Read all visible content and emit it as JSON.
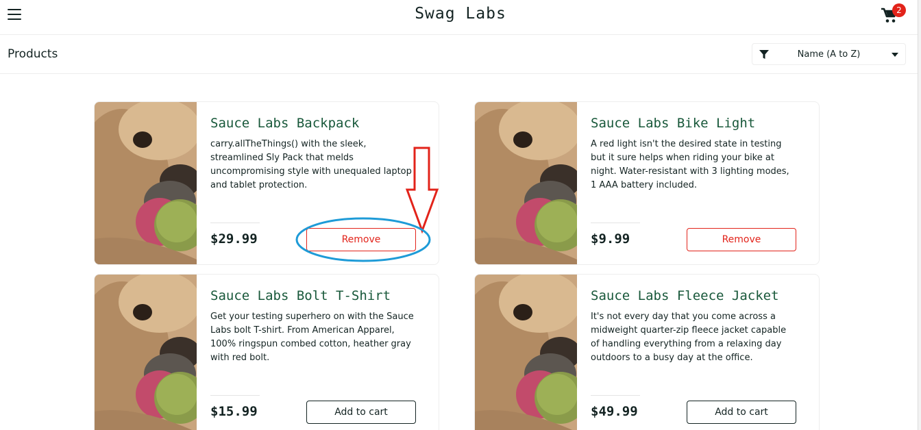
{
  "header": {
    "title": "Swag Labs",
    "menu_icon": "hamburger-menu-icon",
    "cart_icon": "shopping-cart-icon",
    "cart_count": "2"
  },
  "subheader": {
    "title": "Products",
    "sort": {
      "selected": "Name (A to Z)",
      "icon": "filter-icon"
    }
  },
  "products": [
    {
      "name": "Sauce Labs Backpack",
      "description": "carry.allTheThings() with the sleek, streamlined Sly Pack that melds uncompromising style with unequaled laptop and tablet protection.",
      "price": "$29.99",
      "button": "Remove",
      "in_cart": true
    },
    {
      "name": "Sauce Labs Bike Light",
      "description": "A red light isn't the desired state in testing but it sure helps when riding your bike at night. Water-resistant with 3 lighting modes, 1 AAA battery included.",
      "price": "$9.99",
      "button": "Remove",
      "in_cart": true
    },
    {
      "name": "Sauce Labs Bolt T-Shirt",
      "description": "Get your testing superhero on with the Sauce Labs bolt T-shirt. From American Apparel, 100% ringspun combed cotton, heather gray with red bolt.",
      "price": "$15.99",
      "button": "Add to cart",
      "in_cart": false
    },
    {
      "name": "Sauce Labs Fleece Jacket",
      "description": "It's not every day that you come across a midweight quarter-zip fleece jacket capable of handling everything from a relaxing day outdoors to a busy day at the office.",
      "price": "$49.99",
      "button": "Add to cart",
      "in_cart": false
    }
  ],
  "colors": {
    "brand_green": "#18583a",
    "text": "#132322",
    "remove_red": "#e2231a",
    "annotation_arrow": "#e2231a",
    "annotation_ellipse": "#1e9bd7"
  }
}
